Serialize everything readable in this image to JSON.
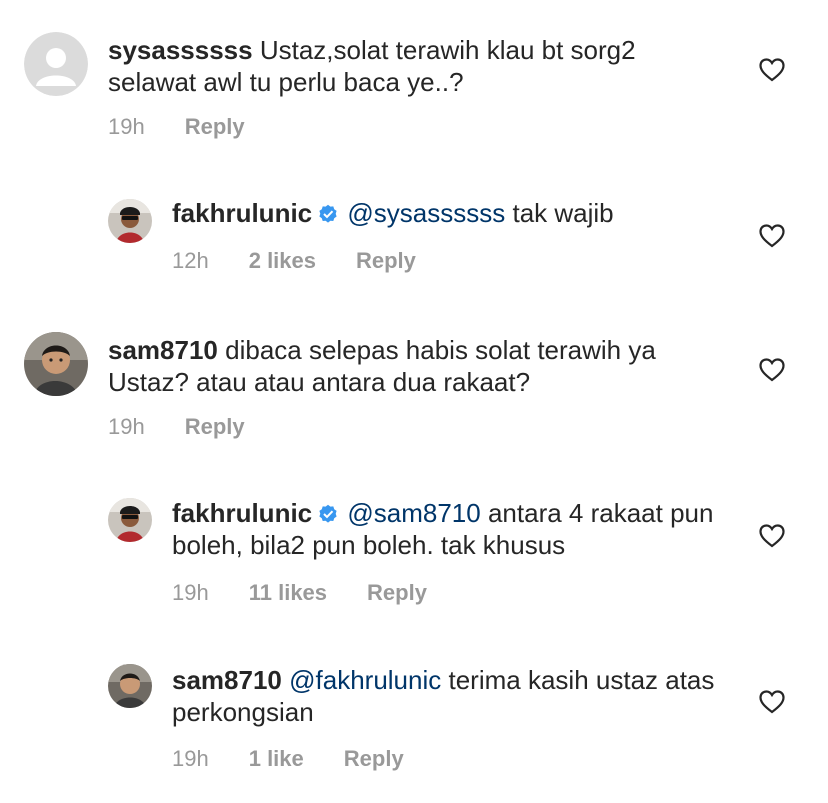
{
  "comments": [
    {
      "username": "sysassssss",
      "mention": "",
      "text": "Ustaz,solat terawih klau bt sorg2 selawat awl tu perlu baca ye..?",
      "time": "19h",
      "likes": "",
      "reply": "Reply"
    },
    {
      "username": "fakhrulunic",
      "mention": "@sysassssss",
      "text": "tak wajib",
      "time": "12h",
      "likes": "2 likes",
      "reply": "Reply"
    },
    {
      "username": "sam8710",
      "mention": "",
      "text": "dibaca selepas habis solat terawih ya Ustaz? atau atau antara dua rakaat?",
      "time": "19h",
      "likes": "",
      "reply": "Reply"
    },
    {
      "username": "fakhrulunic",
      "mention": "@sam8710",
      "text": "antara 4 rakaat pun boleh, bila2 pun boleh. tak khusus",
      "time": "19h",
      "likes": "11 likes",
      "reply": "Reply"
    },
    {
      "username": "sam8710",
      "mention": "@fakhrulunic",
      "text": "terima kasih ustaz atas perkongsian",
      "time": "19h",
      "likes": "1 like",
      "reply": "Reply"
    }
  ],
  "colors": {
    "mention": "#003569",
    "verified": "#3897f0",
    "meta": "#999999"
  }
}
